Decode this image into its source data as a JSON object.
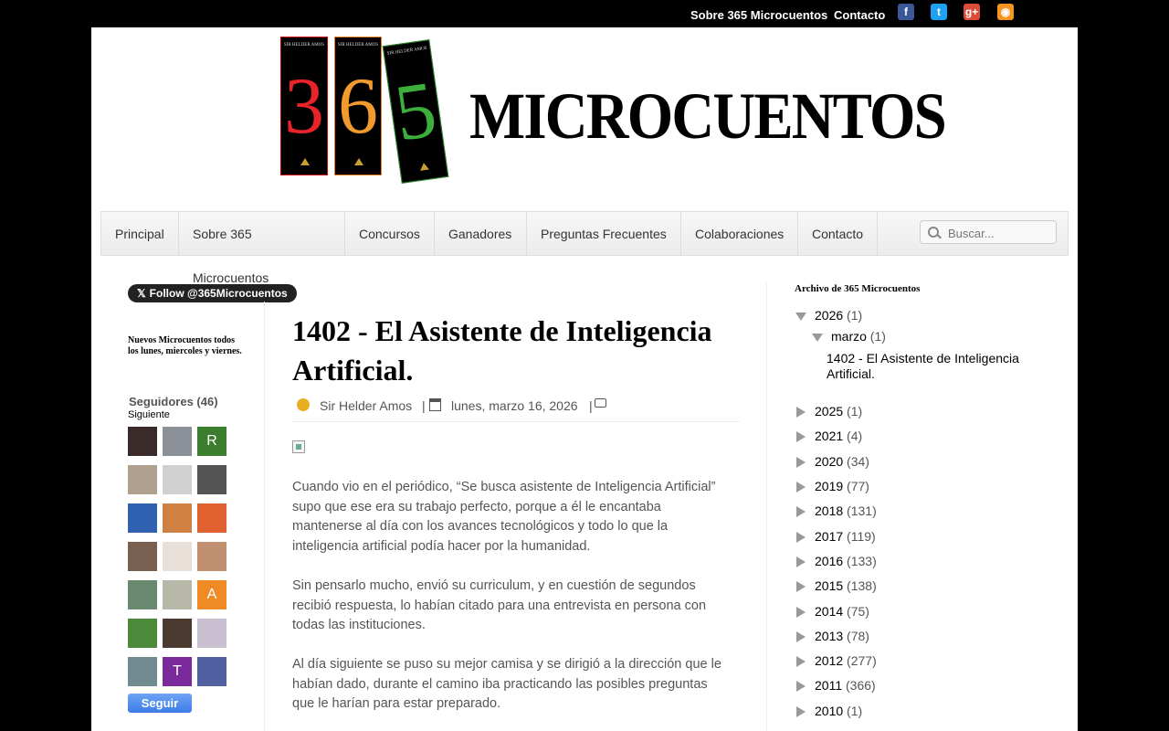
{
  "topbar": {
    "links": [
      "Sobre 365 Microcuentos",
      "Contacto"
    ],
    "social": [
      {
        "icon": "facebook-icon",
        "glyph": "f",
        "color": "#3b5998"
      },
      {
        "icon": "twitter-icon",
        "glyph": "t",
        "color": "#1da1f2"
      },
      {
        "icon": "google-plus-icon",
        "glyph": "g+",
        "color": "#dd4b39"
      },
      {
        "icon": "rss-icon",
        "glyph": "◉",
        "color": "#f7931e"
      }
    ]
  },
  "banner": {
    "books": [
      {
        "num": "3",
        "author": "SIR HELDER AMOS",
        "color": "#e8232a",
        "border": "#c00"
      },
      {
        "num": "6",
        "author": "SIR HELDER AMOS",
        "color": "#f39a2f",
        "border": "#e08020"
      },
      {
        "num": "5",
        "author": "SIR HELDER AMOS",
        "color": "#3cae3c",
        "border": "#2a8a2a"
      }
    ],
    "text": "MICROCUENTOS"
  },
  "nav": {
    "items": [
      "Principal",
      "Sobre 365 Microcuentos",
      "Concursos",
      "Ganadores",
      "Preguntas Frecuentes",
      "Colaboraciones",
      "Contacto"
    ],
    "search_placeholder": "Buscar..."
  },
  "left": {
    "follow_label": "Follow @365Microcuentos",
    "schedule": "Nuevos Microcuentos todos los lunes, miercoles y viernes.",
    "followers_title": "Seguidores (46)",
    "followers_sub": "Siguiente",
    "avatars": [
      {
        "color": "#3a2a2a",
        "letter": ""
      },
      {
        "color": "#8a8f98",
        "letter": ""
      },
      {
        "color": "#3a7d2c",
        "letter": "R"
      },
      {
        "color": "#b0a090",
        "letter": ""
      },
      {
        "color": "#d0d0d0",
        "letter": ""
      },
      {
        "color": "#555",
        "letter": ""
      },
      {
        "color": "#3060b0",
        "letter": ""
      },
      {
        "color": "#d08040",
        "letter": ""
      },
      {
        "color": "#e06030",
        "letter": ""
      },
      {
        "color": "#7a6050",
        "letter": ""
      },
      {
        "color": "#e8e0d8",
        "letter": ""
      },
      {
        "color": "#c09070",
        "letter": ""
      },
      {
        "color": "#6a8a70",
        "letter": ""
      },
      {
        "color": "#b8b8a8",
        "letter": ""
      },
      {
        "color": "#f08a24",
        "letter": "A"
      },
      {
        "color": "#4a8a3a",
        "letter": ""
      },
      {
        "color": "#4a3a30",
        "letter": ""
      },
      {
        "color": "#c8c0d0",
        "letter": ""
      },
      {
        "color": "#708a90",
        "letter": ""
      },
      {
        "color": "#7a2a9a",
        "letter": "T"
      },
      {
        "color": "#5060a0",
        "letter": ""
      }
    ],
    "follow_button": "Seguir"
  },
  "post": {
    "title": "1402 - El Asistente de Inteligencia Artificial.",
    "author": "Sir Helder Amos",
    "date": "lunes, marzo 16, 2026",
    "paragraphs": [
      "Cuando vio en el periódico, “Se busca asistente de Inteligencia Artificial” supo que ese era su trabajo perfecto, porque a él le encantaba mantenerse al día con los avances tecnológicos y todo lo que la inteligencia artificial podía hacer por la humanidad.",
      "Sin pensarlo mucho, envió su curriculum, y en cuestión de segundos recibió respuesta, lo habían citado para una entrevista en persona con todas las instituciones.",
      "Al día siguiente se puso su mejor camisa y se dirigió a la dirección que le habían dado, durante el camino iba practicando las posibles preguntas que le harían para estar preparado."
    ]
  },
  "archive": {
    "title": "Archivo de 365 Microcuentos",
    "open_year": {
      "label": "2026",
      "count": "(1)"
    },
    "open_month": {
      "label": "marzo",
      "count": "(1)"
    },
    "open_post": "1402 - El Asistente de Inteligencia Artificial.",
    "years": [
      {
        "label": "2025",
        "count": "(1)"
      },
      {
        "label": "2021",
        "count": "(4)"
      },
      {
        "label": "2020",
        "count": "(34)"
      },
      {
        "label": "2019",
        "count": "(77)"
      },
      {
        "label": "2018",
        "count": "(131)"
      },
      {
        "label": "2017",
        "count": "(119)"
      },
      {
        "label": "2016",
        "count": "(133)"
      },
      {
        "label": "2015",
        "count": "(138)"
      },
      {
        "label": "2014",
        "count": "(75)"
      },
      {
        "label": "2013",
        "count": "(78)"
      },
      {
        "label": "2012",
        "count": "(277)"
      },
      {
        "label": "2011",
        "count": "(366)"
      },
      {
        "label": "2010",
        "count": "(1)"
      }
    ]
  }
}
